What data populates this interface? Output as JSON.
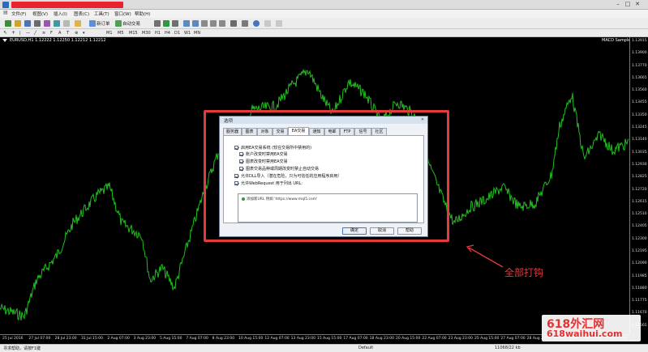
{
  "window": {
    "min": "–",
    "max": "□",
    "close": "✕"
  },
  "menu": [
    "文件(F)",
    "视图(V)",
    "插入(I)",
    "图表(C)",
    "工具(T)",
    "窗口(W)",
    "帮助(H)"
  ],
  "toolbar": {
    "new_order": "新订单",
    "auto_trade": "自动交易"
  },
  "timeframes": [
    "M1",
    "M5",
    "M15",
    "M30",
    "H1",
    "H4",
    "D1",
    "W1",
    "MN"
  ],
  "chart": {
    "symbol_label": "EURUSD,H1  1.12222  1.12250  1.12212  1.12212",
    "ea_label": "MACD Sample ☺",
    "price_labels": [
      "1.13915",
      "1.13900",
      "1.13770",
      "1.13665",
      "1.13560",
      "1.13455",
      "1.13350",
      "1.13245",
      "1.13140",
      "1.13035",
      "1.12930",
      "1.12825",
      "1.12720",
      "1.12615",
      "1.12510",
      "1.12405",
      "1.12300",
      "1.12195",
      "1.12090",
      "1.11985",
      "1.11880",
      "1.11775",
      "1.11670",
      "1.11565"
    ],
    "time_labels": [
      "25 Jul 2016",
      "27 Jul 07:00",
      "28 Jul 23:00",
      "31 Jul 15:00",
      "2 Aug 07:00",
      "3 Aug 23:00",
      "5 Aug 15:00",
      "7 Aug 07:00",
      "8 Aug 23:00",
      "10 Aug 15:00",
      "12 Aug 07:00",
      "13 Aug 23:00",
      "15 Aug 15:00",
      "17 Aug 07:00",
      "18 Aug 23:00",
      "20 Aug 15:00",
      "22 Aug 07:00",
      "23 Aug 23:00",
      "25 Aug 15:00",
      "27 Aug 07:00",
      "28 Aug 23:00",
      "30 Aug 15:00",
      "1 Sep 07:00",
      "2 Sep 23:00"
    ],
    "line_color": "#1fbf1f"
  },
  "dialog": {
    "title": "选项",
    "close": "✕",
    "tabs": [
      "服务器",
      "图表",
      "对象",
      "交易",
      "EA交易",
      "通知",
      "电邮",
      "FTP",
      "信号",
      "社区"
    ],
    "active_tab_index": 4,
    "options": [
      {
        "label": "启用EA交易系统 (较在交易所中禁用的)",
        "checked": true
      },
      {
        "label": "账户改变时禁用EA交易",
        "checked": true
      },
      {
        "label": "图表改变时禁用EA交易",
        "checked": true
      },
      {
        "label": "图表交易品种或周期改变时禁止自动交易",
        "checked": true
      },
      {
        "label": "允许DLL导入（潜在危险，只为可信任的应用程序启用）",
        "checked": true
      },
      {
        "label": "允许WebRequest 用于列出 URL:",
        "checked": true
      }
    ],
    "url_add": "添加新URL 例如 'https://www.mql5.com'",
    "buttons": {
      "ok": "确定",
      "cancel": "取消",
      "help": "帮助"
    }
  },
  "status": {
    "help_hint": "寻求帮助，请按F1键",
    "profile": "Default",
    "traffic": "11068/22 kb"
  },
  "annotation": "全部打钩",
  "watermark": {
    "line1": "618外汇网",
    "line2": "618waihui.com"
  }
}
